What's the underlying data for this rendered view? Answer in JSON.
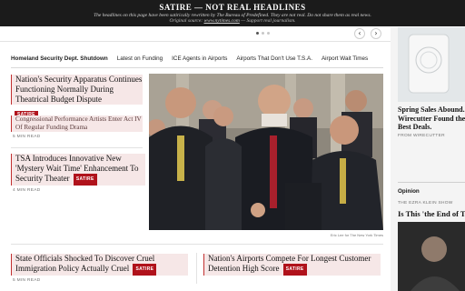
{
  "banner": {
    "title": "SATIRE — NOT REAL HEADLINES",
    "subtitle": "The headlines on this page have been satirically rewritten by The Bureau of Predefined. They are not real. Do not share them as real news.",
    "original_prefix": "Original source:",
    "original_link": "www.nytimes.com",
    "original_suffix": "— Support real journalism."
  },
  "carousel": {
    "prev_icon": "‹",
    "next_icon": "›"
  },
  "nav": {
    "items": [
      "Homeland Security Dept. Shutdown",
      "Latest on Funding",
      "ICE Agents in Airports",
      "Airports That Don't Use T.S.A.",
      "Airport Wait Times"
    ]
  },
  "stories": {
    "s1": {
      "headline": "Nation's Security Apparatus Continues Functioning Normally During Theatrical Budget Dispute",
      "badge": "SATIRE"
    },
    "s1_sub": {
      "headline": "Congressional Performance Artists Enter Act IV Of Regular Funding Drama",
      "meta": "5 MIN READ"
    },
    "s2": {
      "headline": "TSA Introduces Innovative New 'Mystery Wait Time' Enhancement To Security Theater",
      "badge": "SATIRE",
      "meta": "4 MIN READ"
    },
    "s3": {
      "headline": "State Officials Shocked To Discover Cruel Immigration Policy Actually Cruel",
      "badge": "SATIRE",
      "meta": "5 MIN READ"
    },
    "s4": {
      "headline": "Nation's Airports Compete For Longest Customer Detention High Score",
      "badge": "SATIRE"
    }
  },
  "photo": {
    "credit": "Eric Lee for The New York Times"
  },
  "rail": {
    "promo_title_1": "Spring Sales Abound.",
    "promo_title_2": "Wirecutter Found the",
    "promo_title_3": "Best Deals.",
    "promo_from": "FROM WIRECUTTER",
    "opinion_label": "Opinion",
    "opinion_author": "THE EZRA KLEIN SHOW",
    "opinion_title": "Is This 'the End of Tru"
  },
  "colors": {
    "accent": "#b0121b",
    "banner_bg": "#1b1b1b"
  }
}
